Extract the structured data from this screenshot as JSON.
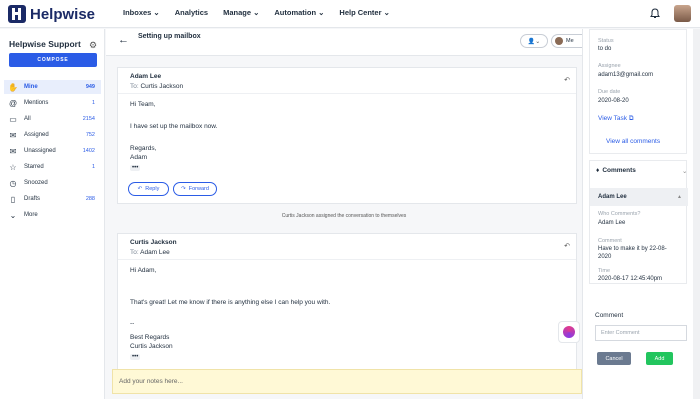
{
  "app": {
    "name": "Helpwise"
  },
  "nav": {
    "items": [
      "Inboxes ⌄",
      "Analytics",
      "Manage ⌄",
      "Automation ⌄",
      "Help Center ⌄"
    ]
  },
  "sidebar": {
    "title": "Helpwise Support",
    "compose": "COMPOSE",
    "items": [
      {
        "label": "Mine",
        "count": "949",
        "icon": "hand-icon"
      },
      {
        "label": "Mentions",
        "count": "1",
        "icon": "at-icon"
      },
      {
        "label": "All",
        "count": "2154",
        "icon": "inbox-icon"
      },
      {
        "label": "Assigned",
        "count": "752",
        "icon": "envelope-icon"
      },
      {
        "label": "Unassigned",
        "count": "1402",
        "icon": "envelope-open-icon"
      },
      {
        "label": "Starred",
        "count": "1",
        "icon": "star-icon"
      },
      {
        "label": "Snoozed",
        "count": "",
        "icon": "clock-icon"
      },
      {
        "label": "Drafts",
        "count": "288",
        "icon": "file-icon"
      },
      {
        "label": "More",
        "count": "",
        "icon": "chevron-down-icon"
      }
    ]
  },
  "thread": {
    "subject": "Setting up mailbox",
    "assignee_short": "Me",
    "system_note": "Curtis Jackson assigned the conversation to themselves",
    "messages": [
      {
        "from": "Adam Lee",
        "to_label": "To:",
        "to": "Curtis Jackson",
        "lines": [
          "Hi Team,",
          "I have set up the mailbox now.",
          "Regards,",
          "Adam"
        ],
        "reply": "Reply",
        "forward": "Forward"
      },
      {
        "from": "Curtis Jackson",
        "to_label": "To:",
        "to": "Adam Lee",
        "lines": [
          "Hi Adam,",
          "That's great! Let me know if there is anything else I can help you with.",
          "--",
          "Best Regards",
          "Curtis Jackson"
        ]
      }
    ],
    "more_dots": "•••",
    "notes_placeholder": "Add your notes here..."
  },
  "task": {
    "status_label": "Status",
    "status": "to do",
    "assignee_label": "Assignee",
    "assignee": "adam13@gmail.com",
    "due_label": "Due date",
    "due": "2020-08-20",
    "view_task": "View Task",
    "view_all": "View all comments"
  },
  "comments": {
    "title": "Comments",
    "author": "Adam Lee",
    "who_label": "Who Comments?",
    "who": "Adam Lee",
    "comment_label": "Comment",
    "comment_lines": [
      "Have to make it by 22-08-",
      "2020"
    ],
    "time_label": "Time",
    "time": "2020-08-17 12:45:40pm",
    "form_label": "Comment",
    "placeholder": "Enter Comment",
    "cancel": "Cancel",
    "add": "Add"
  },
  "colors": {
    "accent": "#2b5ce6",
    "brand": "#1b2a66",
    "add": "#22c55e",
    "cancel": "#6b7a90",
    "notes_bg": "#fff9d6"
  }
}
